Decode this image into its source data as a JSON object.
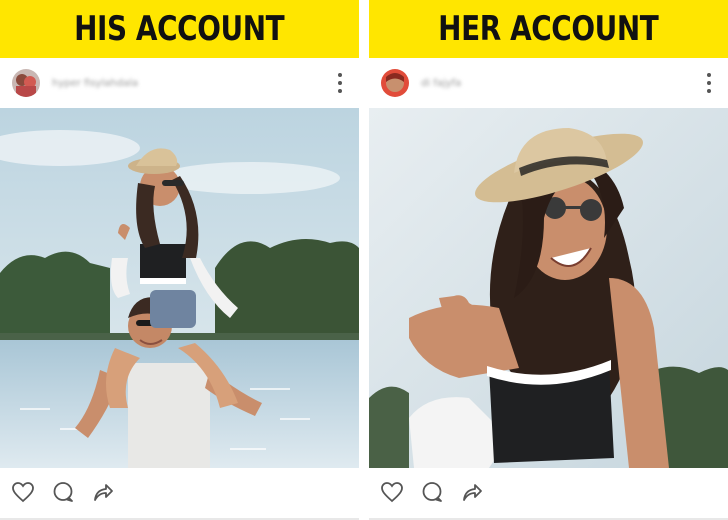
{
  "panels": [
    {
      "banner_title": "HIS ACCOUNT",
      "username": "hyper fisylahdala",
      "avatar": "couple-avatar",
      "photo_alt": "man carrying woman on shoulders by the lake"
    },
    {
      "banner_title": "HER ACCOUNT",
      "username": "di fajyfa",
      "avatar": "woman-avatar",
      "photo_alt": "woman in straw hat laughing by the lake"
    }
  ],
  "icons": {
    "more": "more-vertical-icon",
    "like": "heart-icon",
    "comment": "comment-icon",
    "share": "share-icon"
  },
  "colors": {
    "banner": "#ffe600",
    "banner_text": "#111111",
    "icon": "#555555"
  }
}
